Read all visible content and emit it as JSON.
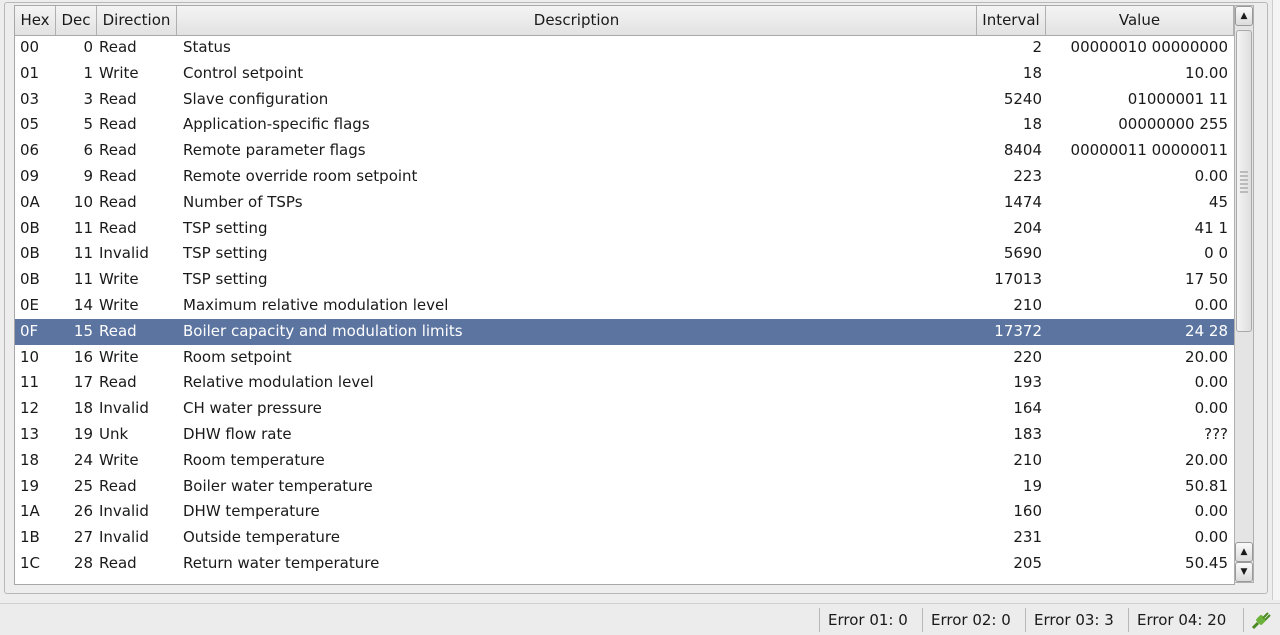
{
  "columns": [
    "Hex",
    "Dec",
    "Direction",
    "Description",
    "Interval",
    "Value"
  ],
  "rows": [
    [
      "00",
      "0",
      "Read",
      "Status",
      "2",
      "00000010 00000000"
    ],
    [
      "01",
      "1",
      "Write",
      "Control setpoint",
      "18",
      "10.00"
    ],
    [
      "03",
      "3",
      "Read",
      "Slave configuration",
      "5240",
      "01000001 11"
    ],
    [
      "05",
      "5",
      "Read",
      "Application-specific flags",
      "18",
      "00000000 255"
    ],
    [
      "06",
      "6",
      "Read",
      "Remote parameter flags",
      "8404",
      "00000011 00000011"
    ],
    [
      "09",
      "9",
      "Read",
      "Remote override room setpoint",
      "223",
      "0.00"
    ],
    [
      "0A",
      "10",
      "Read",
      "Number of TSPs",
      "1474",
      "45"
    ],
    [
      "0B",
      "11",
      "Read",
      "TSP setting",
      "204",
      "41 1"
    ],
    [
      "0B",
      "11",
      "Invalid",
      "TSP setting",
      "5690",
      "0 0"
    ],
    [
      "0B",
      "11",
      "Write",
      "TSP setting",
      "17013",
      "17 50"
    ],
    [
      "0E",
      "14",
      "Write",
      "Maximum relative modulation level",
      "210",
      "0.00"
    ],
    [
      "0F",
      "15",
      "Read",
      "Boiler capacity and modulation limits",
      "17372",
      "24 28"
    ],
    [
      "10",
      "16",
      "Write",
      "Room setpoint",
      "220",
      "20.00"
    ],
    [
      "11",
      "17",
      "Read",
      "Relative modulation level",
      "193",
      "0.00"
    ],
    [
      "12",
      "18",
      "Invalid",
      "CH water pressure",
      "164",
      "0.00"
    ],
    [
      "13",
      "19",
      "Unk",
      "DHW flow rate",
      "183",
      "???"
    ],
    [
      "18",
      "24",
      "Write",
      "Room temperature",
      "210",
      "20.00"
    ],
    [
      "19",
      "25",
      "Read",
      "Boiler water temperature",
      "19",
      "50.81"
    ],
    [
      "1A",
      "26",
      "Invalid",
      "DHW temperature",
      "160",
      "0.00"
    ],
    [
      "1B",
      "27",
      "Invalid",
      "Outside temperature",
      "231",
      "0.00"
    ],
    [
      "1C",
      "28",
      "Read",
      "Return water temperature",
      "205",
      "50.45"
    ]
  ],
  "selected_row": 11,
  "status": {
    "errors": [
      "Error 01: 0",
      "Error 02: 0",
      "Error 03: 3",
      "Error 04: 20"
    ],
    "connection_icon": "plug-connected-icon"
  },
  "colors": {
    "selection": "#5b74a0",
    "connection": "#5aa02c"
  }
}
